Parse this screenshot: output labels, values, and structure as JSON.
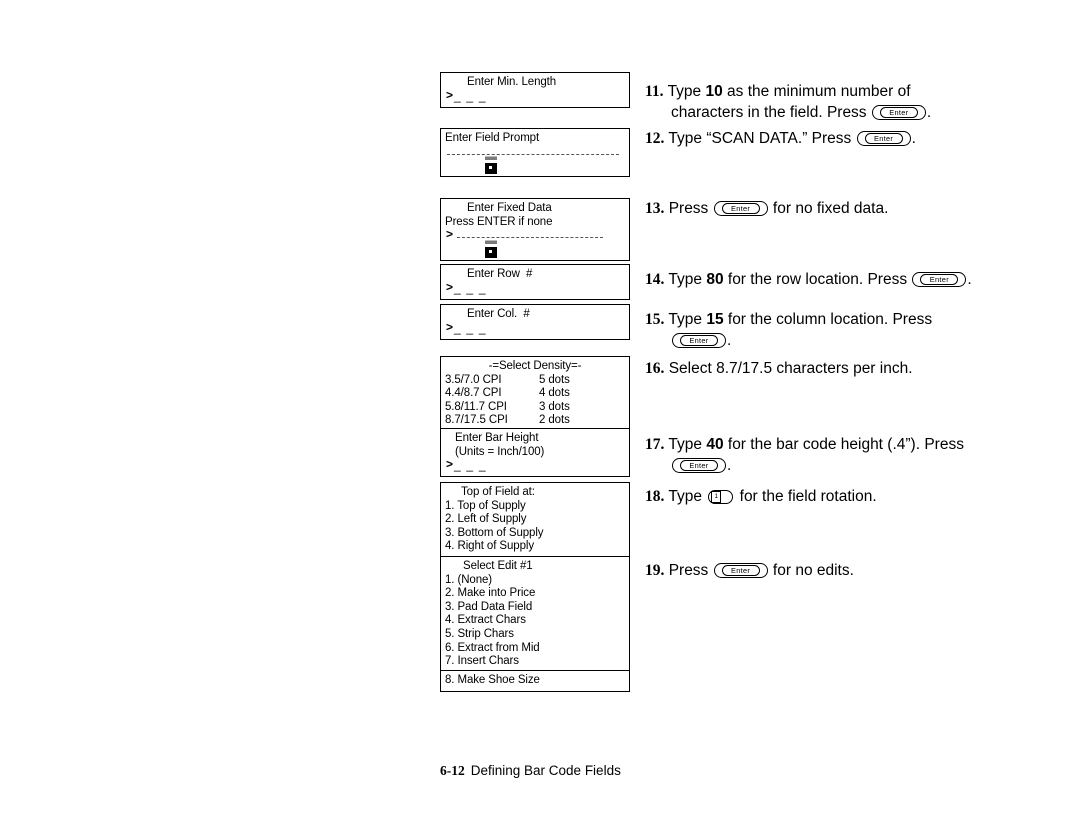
{
  "document": {
    "footer": {
      "page_number": "6-12",
      "title": "Defining Bar Code Fields"
    }
  },
  "keys": {
    "enter_label": "Enter",
    "one_label": "1"
  },
  "lcd_screens": [
    {
      "id": "enter-min-length",
      "title": "Enter Min. Length",
      "entry_prefix": ">",
      "entry_underscores": "_ _ _"
    },
    {
      "id": "enter-field-prompt",
      "title": "Enter Field Prompt"
    },
    {
      "id": "enter-fixed-data",
      "title": "Enter Fixed Data",
      "subtitle": "Press ENTER if none",
      "entry_prefix": ">"
    },
    {
      "id": "enter-row-number",
      "title": "Enter Row  #",
      "entry_prefix": ">",
      "entry_underscores": "_ _ _"
    },
    {
      "id": "enter-col-number",
      "title": "Enter Col.  #",
      "entry_prefix": ">",
      "entry_underscores": "_ _ _"
    },
    {
      "id": "select-density",
      "title": "-=Select Density=-",
      "options": [
        {
          "label": "3.5/7.0 CPI",
          "value": "5 dots"
        },
        {
          "label": "4.4/8.7 CPI",
          "value": "4 dots"
        },
        {
          "label": "5.8/11.7 CPI",
          "value": "3 dots"
        },
        {
          "label": "8.7/17.5 CPI",
          "value": "2 dots"
        }
      ]
    },
    {
      "id": "enter-bar-height",
      "title": "Enter Bar Height",
      "subtitle": "(Units = Inch/100)",
      "entry_prefix": ">",
      "entry_underscores": "_ _ _"
    },
    {
      "id": "top-of-field-at",
      "title": "Top of Field at:",
      "options": [
        "1. Top of Supply",
        "2. Left of Supply",
        "3. Bottom of Supply",
        "4. Right of Supply"
      ]
    },
    {
      "id": "select-edit-1",
      "title": "Select Edit #1",
      "options": [
        "1. (None)",
        "2. Make into Price",
        "3. Pad Data Field",
        "4. Extract Chars",
        "5. Strip Chars",
        "6. Extract from Mid",
        "7. Insert Chars"
      ]
    },
    {
      "id": "make-shoe-size",
      "title": "8. Make Shoe Size"
    }
  ],
  "steps": [
    {
      "number": "11.",
      "part1": "Type ",
      "bold1": "10",
      "part2": " as the minimum number of",
      "line2_a": "characters in the field.  Press ",
      "line2_b": "."
    },
    {
      "number": "12.",
      "part1": "Type “SCAN DATA.”  Press ",
      "part2": "."
    },
    {
      "number": "13.",
      "part1": "Press ",
      "part2": " for no fixed data."
    },
    {
      "number": "14.",
      "part1": "Type ",
      "bold1": "80",
      "part2": " for the row location.  Press ",
      "part3": "."
    },
    {
      "number": "15.",
      "part1": "Type ",
      "bold1": "15",
      "part2": " for the column location.  Press",
      "line2_b": "."
    },
    {
      "number": "16.",
      "part1": "Select 8.7/17.5 characters per inch."
    },
    {
      "number": "17.",
      "part1": "Type ",
      "bold1": "40",
      "part2": " for the bar code height (.4”).  Press",
      "line2_b": "."
    },
    {
      "number": "18.",
      "part1": "Type ",
      "part2": " for the field rotation."
    },
    {
      "number": "19.",
      "part1": "Press ",
      "part2": " for no edits."
    }
  ]
}
